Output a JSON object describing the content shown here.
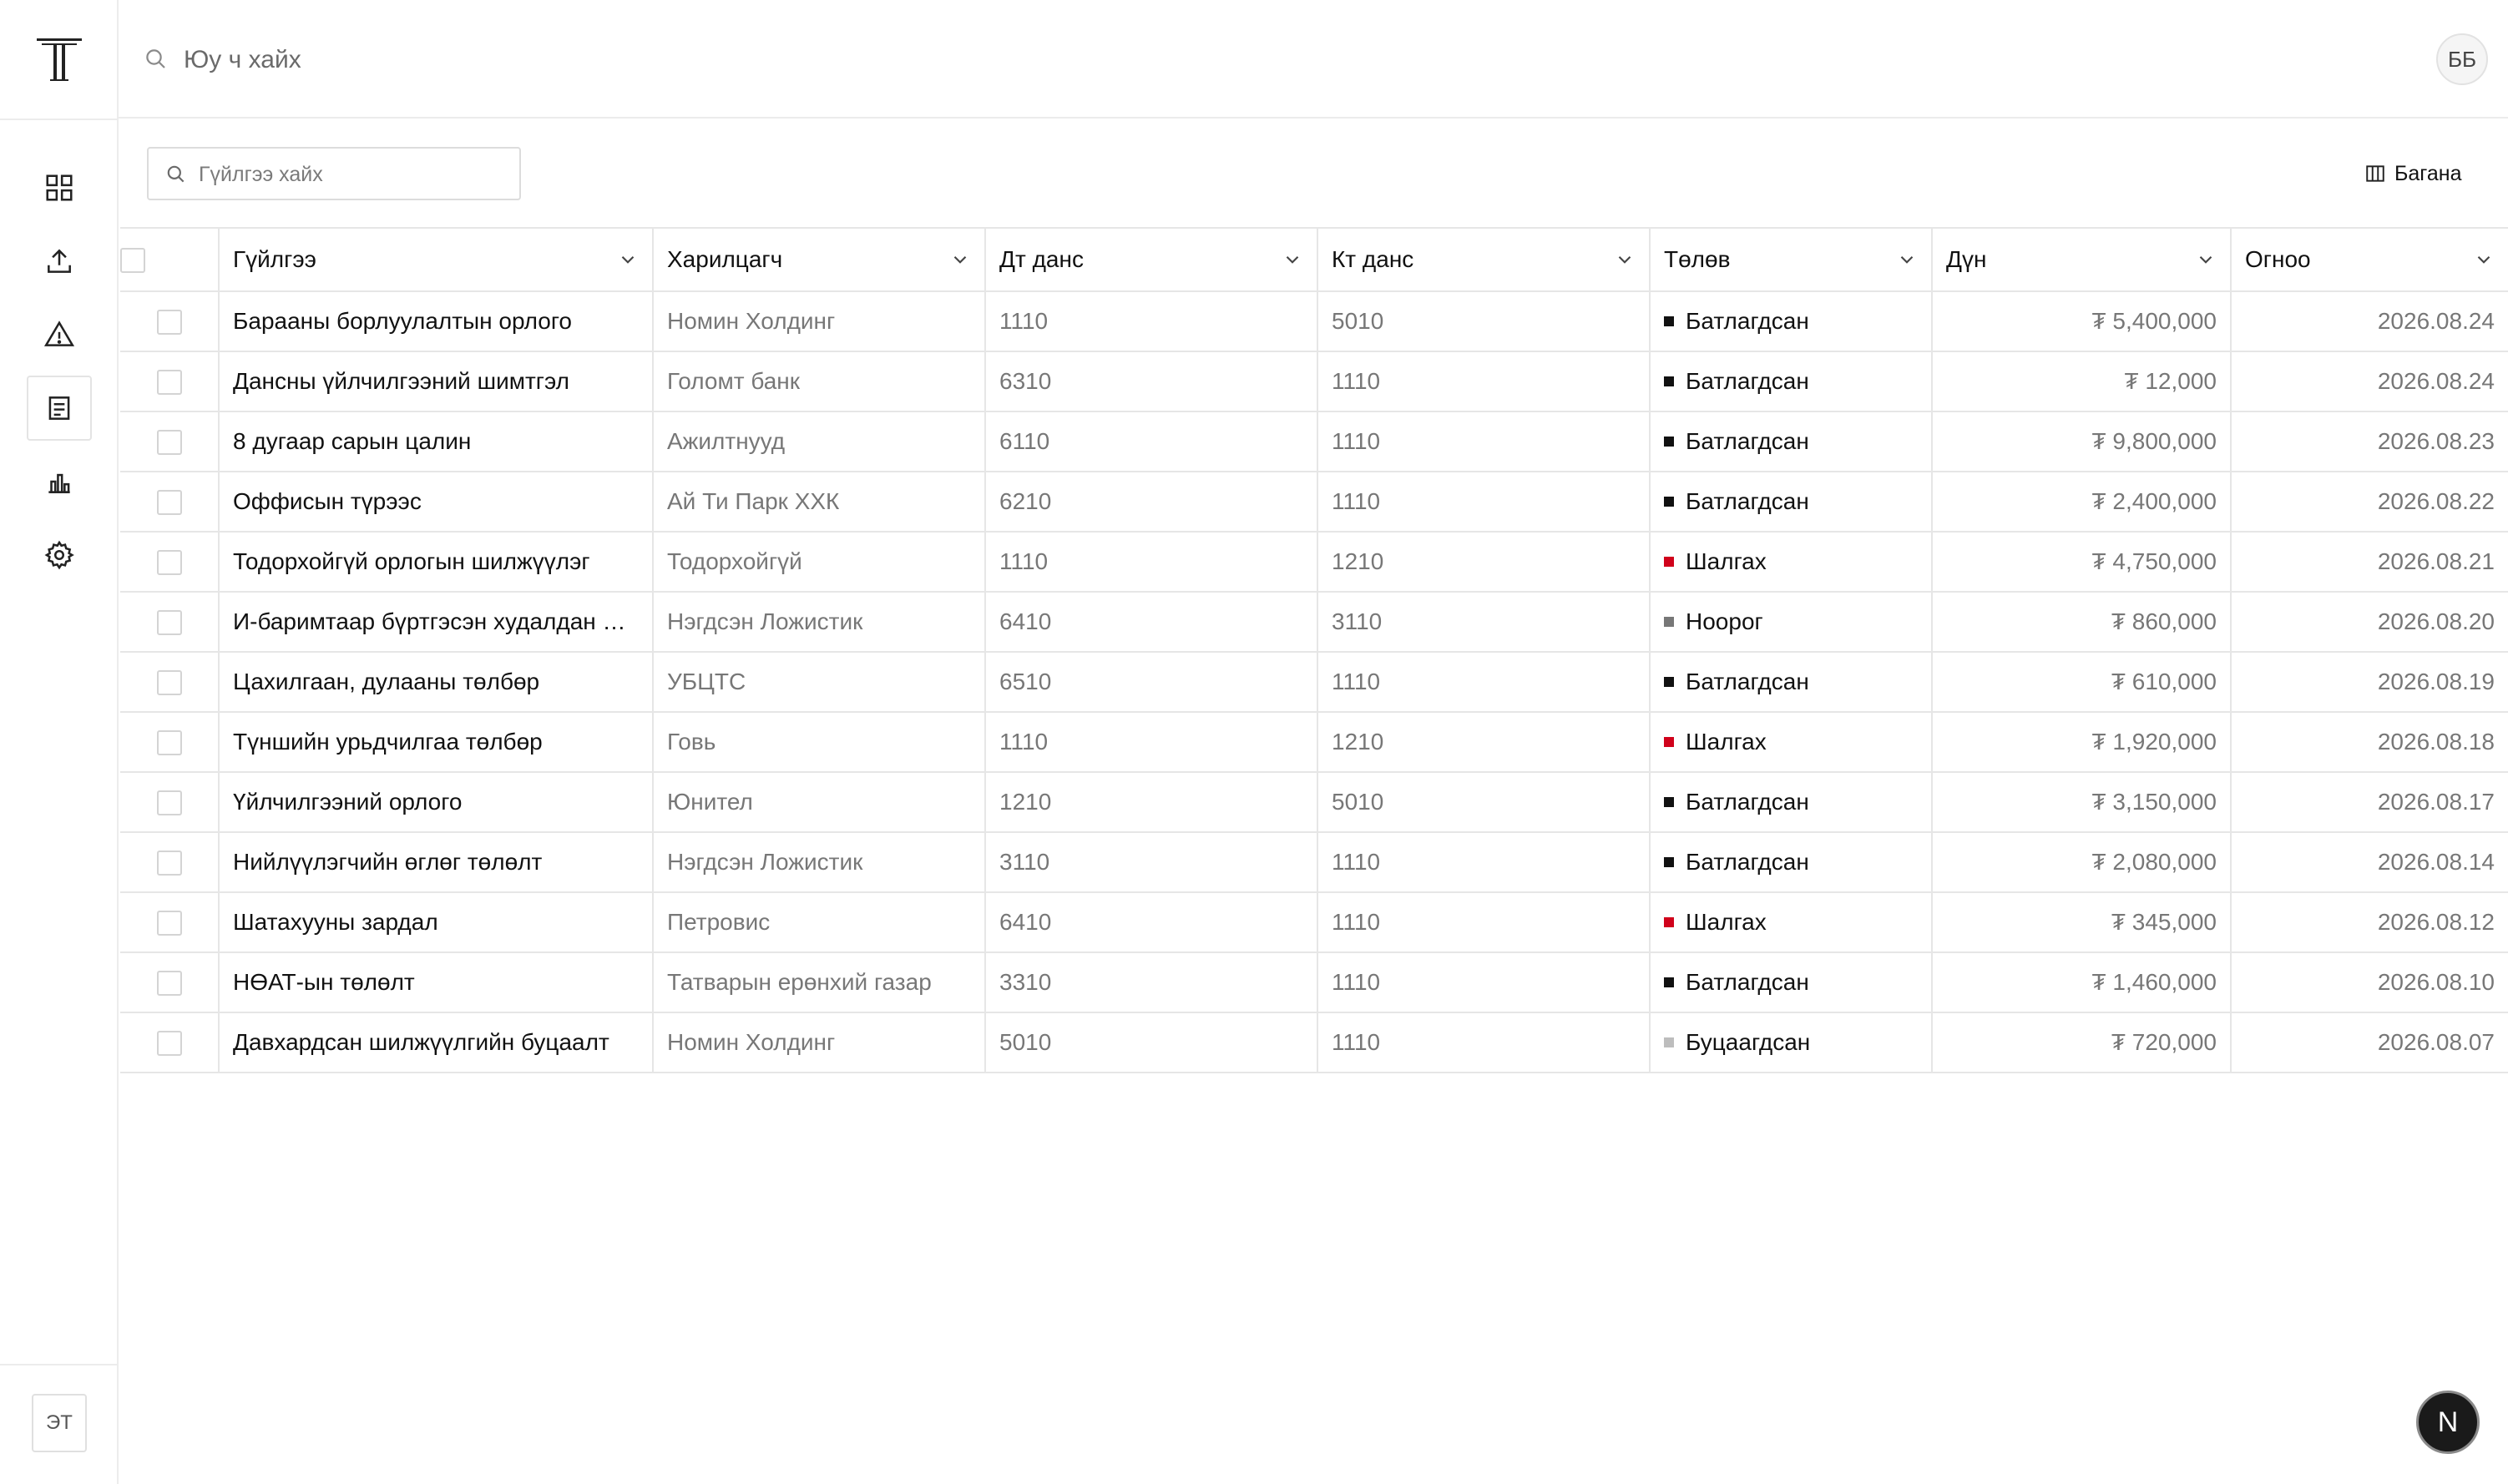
{
  "topbar": {
    "search_placeholder": "Юу ч хайх",
    "avatar_initials": "ББ"
  },
  "sidebar": {
    "items": [
      {
        "name": "dashboard",
        "icon": "grid-icon",
        "active": false
      },
      {
        "name": "upload",
        "icon": "upload-icon",
        "active": false
      },
      {
        "name": "alerts",
        "icon": "warning-icon",
        "active": false
      },
      {
        "name": "transactions",
        "icon": "document-icon",
        "active": true
      },
      {
        "name": "reports",
        "icon": "bar-chart-icon",
        "active": false
      },
      {
        "name": "settings",
        "icon": "gear-icon",
        "active": false
      }
    ],
    "user_chip": "ЭТ"
  },
  "toolbar": {
    "filter_placeholder": "Гүйлгээ хайх",
    "columns_label": "Багана"
  },
  "table": {
    "headers": [
      "Гүйлгээ",
      "Харилцагч",
      "Дт данс",
      "Кт данс",
      "Төлөв",
      "Дүн",
      "Огноо"
    ],
    "status_colors": {
      "Батлагдсан": "#111111",
      "Шалгах": "#d0021b",
      "Ноорог": "#777777",
      "Буцаагдсан": "#bdbdbd"
    },
    "rows": [
      {
        "name": "Барааны борлуулалтын орлого",
        "party": "Номин Холдинг",
        "dt": "1110",
        "kt": "5010",
        "status": "Батлагдсан",
        "amount": "₮ 5,400,000",
        "date": "2026.08.24"
      },
      {
        "name": "Дансны үйлчилгээний шимтгэл",
        "party": "Голомт банк",
        "dt": "6310",
        "kt": "1110",
        "status": "Батлагдсан",
        "amount": "₮ 12,000",
        "date": "2026.08.24"
      },
      {
        "name": "8 дугаар сарын цалин",
        "party": "Ажилтнууд",
        "dt": "6110",
        "kt": "1110",
        "status": "Батлагдсан",
        "amount": "₮ 9,800,000",
        "date": "2026.08.23"
      },
      {
        "name": "Оффисын түрээс",
        "party": "Ай Ти Парк ХХК",
        "dt": "6210",
        "kt": "1110",
        "status": "Батлагдсан",
        "amount": "₮ 2,400,000",
        "date": "2026.08.22"
      },
      {
        "name": "Тодорхойгүй орлогын шилжүүлэг",
        "party": "Тодорхойгүй",
        "dt": "1110",
        "kt": "1210",
        "status": "Шалгах",
        "amount": "₮ 4,750,000",
        "date": "2026.08.21"
      },
      {
        "name": "И-баримтаар бүртгэсэн худалдан авалт",
        "party": "Нэгдсэн Ложистик",
        "dt": "6410",
        "kt": "3110",
        "status": "Ноорог",
        "amount": "₮ 860,000",
        "date": "2026.08.20"
      },
      {
        "name": "Цахилгаан, дулааны төлбөр",
        "party": "УБЦТС",
        "dt": "6510",
        "kt": "1110",
        "status": "Батлагдсан",
        "amount": "₮ 610,000",
        "date": "2026.08.19"
      },
      {
        "name": "Түншийн урьдчилгаа төлбөр",
        "party": "Говь",
        "dt": "1110",
        "kt": "1210",
        "status": "Шалгах",
        "amount": "₮ 1,920,000",
        "date": "2026.08.18"
      },
      {
        "name": "Үйлчилгээний орлого",
        "party": "Юнител",
        "dt": "1210",
        "kt": "5010",
        "status": "Батлагдсан",
        "amount": "₮ 3,150,000",
        "date": "2026.08.17"
      },
      {
        "name": "Нийлүүлэгчийн өглөг төлөлт",
        "party": "Нэгдсэн Ложистик",
        "dt": "3110",
        "kt": "1110",
        "status": "Батлагдсан",
        "amount": "₮ 2,080,000",
        "date": "2026.08.14"
      },
      {
        "name": "Шатахууны зардал",
        "party": "Петровис",
        "dt": "6410",
        "kt": "1110",
        "status": "Шалгах",
        "amount": "₮ 345,000",
        "date": "2026.08.12"
      },
      {
        "name": "НӨАТ-ын төлөлт",
        "party": "Татварын ерөнхий газар",
        "dt": "3310",
        "kt": "1110",
        "status": "Батлагдсан",
        "amount": "₮ 1,460,000",
        "date": "2026.08.10"
      },
      {
        "name": "Давхардсан шилжүүлгийн буцаалт",
        "party": "Номин Холдинг",
        "dt": "5010",
        "kt": "1110",
        "status": "Буцаагдсан",
        "amount": "₮ 720,000",
        "date": "2026.08.07"
      }
    ]
  },
  "fab_label": "N"
}
